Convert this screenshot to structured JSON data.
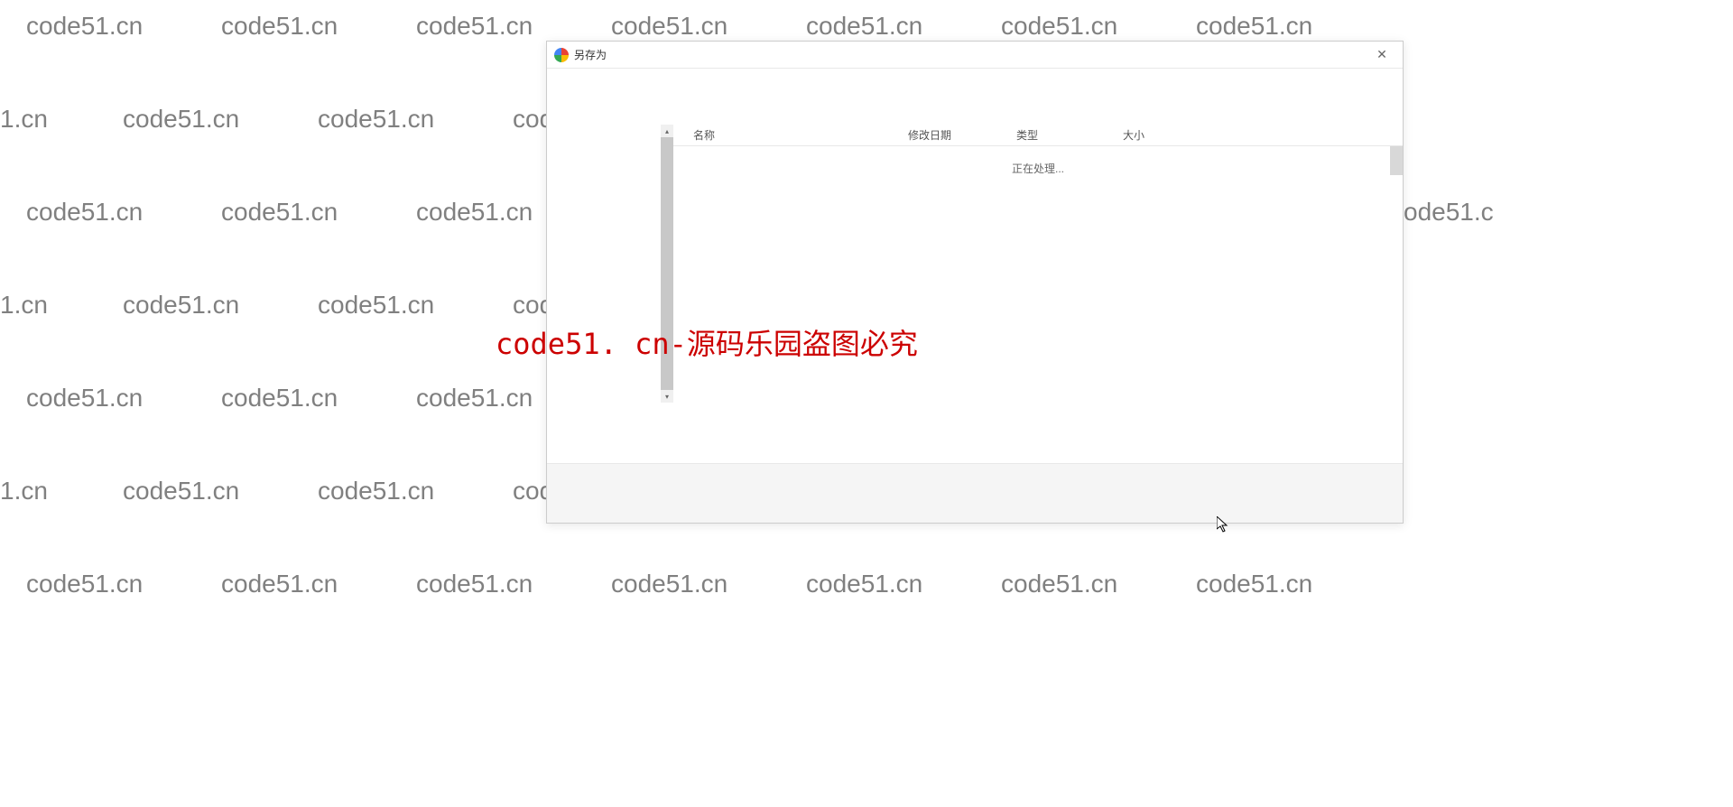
{
  "watermark": {
    "text": "code51.cn",
    "text_partial_left": "1.cn",
    "text_partial_right": "code51.c",
    "red_text": "code51. cn-源码乐园盗图必究"
  },
  "dialog": {
    "title": "另存为",
    "columns": {
      "name": "名称",
      "date": "修改日期",
      "type": "类型",
      "size": "大小"
    },
    "processing": "正在处理..."
  }
}
